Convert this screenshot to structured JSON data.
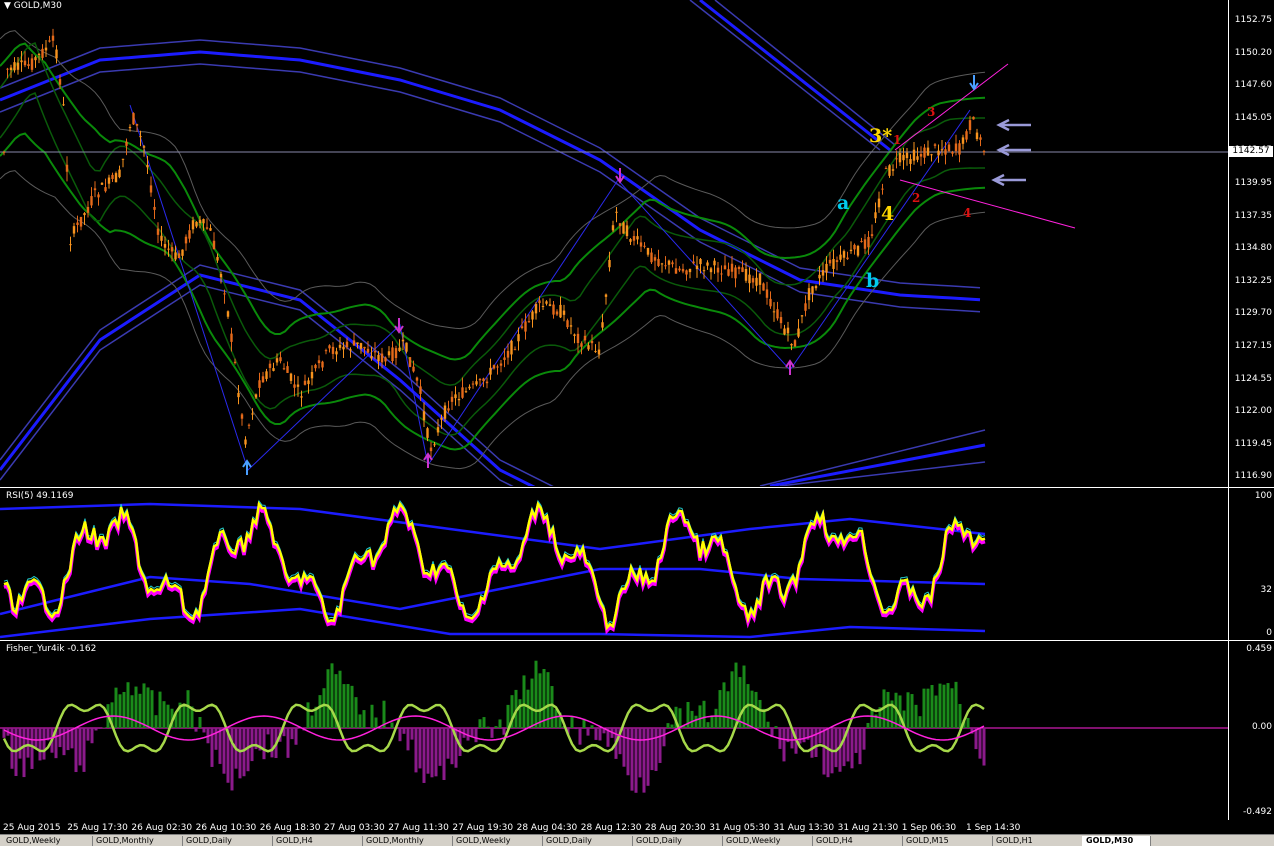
{
  "main_chart": {
    "title": "GOLD,M30",
    "current_price": "1142.57",
    "price_axis": [
      "1152.75",
      "1150.20",
      "1147.60",
      "1145.05",
      "1142.45",
      "1139.95",
      "1137.35",
      "1134.80",
      "1132.25",
      "1129.70",
      "1127.15",
      "1124.55",
      "1122.00",
      "1119.45",
      "1116.90"
    ],
    "wave_labels": {
      "a": "a",
      "b": "b",
      "three_star": "3*",
      "four": "4",
      "small_1": "1",
      "small_2": "2",
      "small_3": "3",
      "small_4": "4"
    },
    "colors": {
      "bull": "#f7931e",
      "bear": "#e56a1a",
      "bands_blue": "#1c1cff",
      "bands_green": "#0a8a0a",
      "trend": "#ff22dd"
    }
  },
  "rsi_panel": {
    "title": "RSI(5) 49.1169",
    "axis": [
      "100",
      "32",
      "0"
    ],
    "colors": {
      "main": "#ffff00",
      "shadow": "#ff00ff",
      "band": "#1c1cff"
    }
  },
  "fisher_panel": {
    "title": "Fisher_Yur4ik -0.162",
    "axis": [
      "0.459",
      "0.00",
      "-0.492"
    ],
    "colors": {
      "positive": "#1a8a1a",
      "negative": "#8b1a8b",
      "line": "#a6d84a",
      "signal": "#ff22dd"
    }
  },
  "time_axis": [
    "25 Aug 2015",
    "25 Aug 17:30",
    "26 Aug 02:30",
    "26 Aug 10:30",
    "26 Aug 18:30",
    "27 Aug 03:30",
    "27 Aug 11:30",
    "27 Aug 19:30",
    "28 Aug 04:30",
    "28 Aug 12:30",
    "28 Aug 20:30",
    "31 Aug 05:30",
    "31 Aug 13:30",
    "31 Aug 21:30",
    "1 Sep 06:30",
    "1 Sep 14:30"
  ],
  "tabs": [
    "GOLD,Weekly",
    "GOLD,Monthly",
    "GOLD,Daily",
    "GOLD,H4",
    "GOLD,Monthly",
    "GOLD,Weekly",
    "GOLD,Daily",
    "GOLD,Daily",
    "GOLD,Weekly",
    "GOLD,H4",
    "GOLD,M15",
    "GOLD,H1",
    "GOLD,M30"
  ]
}
